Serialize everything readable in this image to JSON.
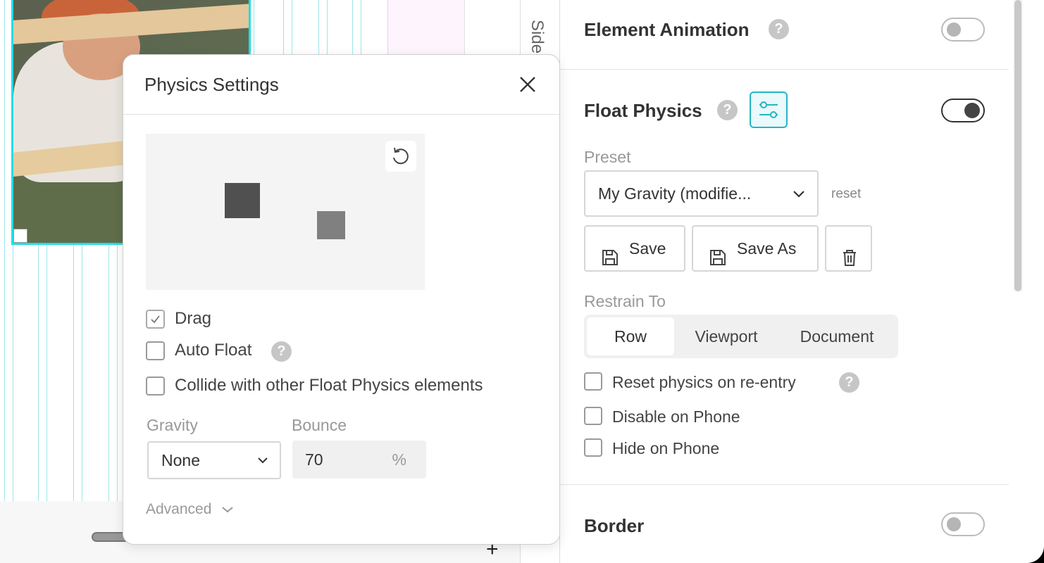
{
  "canvas": {
    "sidebar_label": "Side",
    "plus_label": "+"
  },
  "modal": {
    "title": "Physics Settings",
    "checkboxes": [
      {
        "label": "Drag",
        "checked": true
      },
      {
        "label": "Auto Float",
        "checked": false
      },
      {
        "label": "Collide with other Float Physics elements",
        "checked": false
      }
    ],
    "gravity": {
      "label": "Gravity",
      "value": "None"
    },
    "bounce": {
      "label": "Bounce",
      "value": "70",
      "unit": "%"
    },
    "advanced_label": "Advanced"
  },
  "panel": {
    "element_animation": {
      "title": "Element Animation",
      "help": "?",
      "enabled": false
    },
    "float_physics": {
      "title": "Float Physics",
      "help": "?",
      "enabled": true,
      "preset": {
        "label": "Preset",
        "value": "My Gravity (modifie...",
        "reset_label": "reset"
      },
      "buttons": {
        "save": "Save",
        "save_as": "Save As"
      },
      "restrain_to": {
        "label": "Restrain To",
        "options": [
          "Row",
          "Viewport",
          "Document"
        ],
        "selected": "Row"
      },
      "options": [
        {
          "label": "Reset physics on re-entry",
          "checked": false,
          "help": "?"
        },
        {
          "label": "Disable on Phone",
          "checked": false
        },
        {
          "label": "Hide on Phone",
          "checked": false
        }
      ]
    },
    "border": {
      "title": "Border",
      "enabled": false
    }
  },
  "colors": {
    "accent": "#23b6c4",
    "guide": "#9be7ea",
    "selection": "#22dde6"
  }
}
